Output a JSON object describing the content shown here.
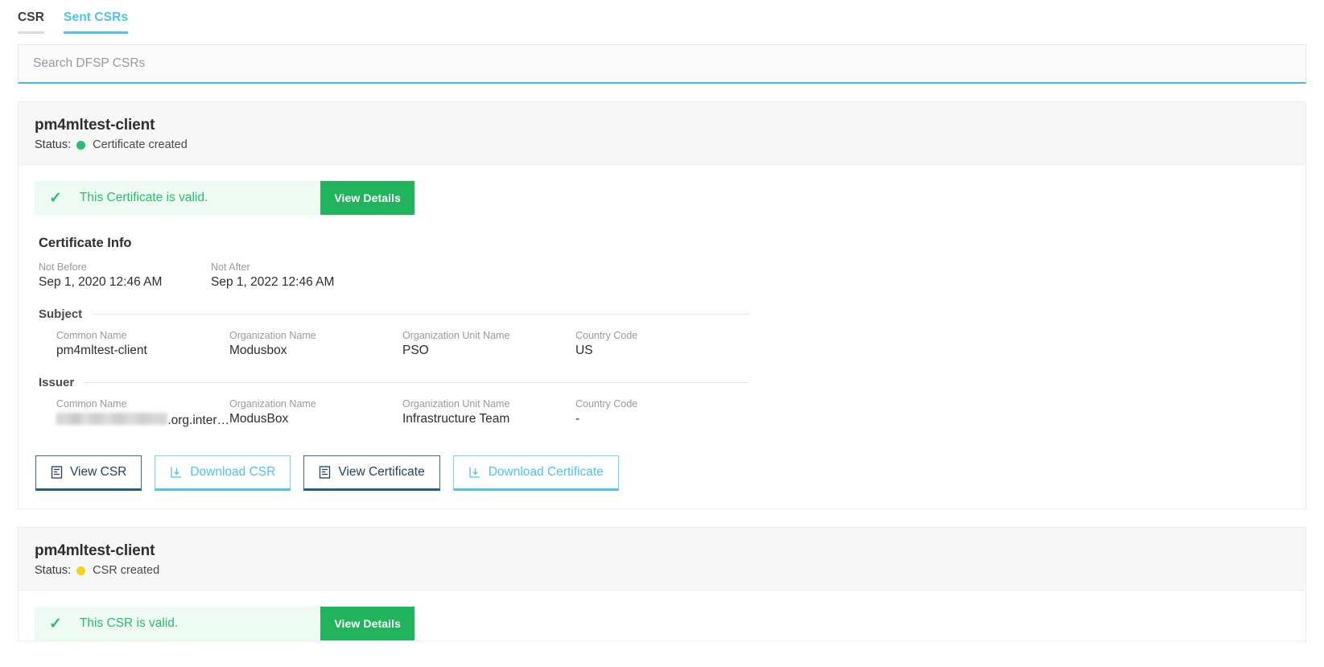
{
  "tabs": [
    {
      "label": "CSR",
      "active": false
    },
    {
      "label": "Sent CSRs",
      "active": true
    }
  ],
  "search": {
    "placeholder": "Search DFSP CSRs",
    "value": ""
  },
  "colors": {
    "accent": "#4ec3f0",
    "success": "#2bbd6b",
    "success_button": "#22b35d",
    "success_bg": "#edfbf2",
    "warning": "#f6d115",
    "dark_button": "#21435e",
    "header_bg": "#f7f7f7"
  },
  "cards": [
    {
      "title": "pm4mltest-client",
      "status_label": "Status:",
      "status_dot": "green",
      "status_text": "Certificate created",
      "alert": {
        "icon": "check-icon",
        "text": "This Certificate is valid.",
        "button": "View Details"
      },
      "section_title": "Certificate Info",
      "validity": [
        {
          "label": "Not Before",
          "value": "Sep 1, 2020 12:46 AM"
        },
        {
          "label": "Not After",
          "value": "Sep 1, 2022 12:46 AM"
        }
      ],
      "subject": {
        "heading": "Subject",
        "fields": [
          {
            "label": "Common Name",
            "value": "pm4mltest-client"
          },
          {
            "label": "Organization Name",
            "value": "Modusbox"
          },
          {
            "label": "Organization Unit Name",
            "value": "PSO"
          },
          {
            "label": "Country Code",
            "value": "US"
          }
        ]
      },
      "issuer": {
        "heading": "Issuer",
        "fields": [
          {
            "label": "Common Name",
            "value": ".org.inter…",
            "redacted": true
          },
          {
            "label": "Organization Name",
            "value": "ModusBox"
          },
          {
            "label": "Organization Unit Name",
            "value": "Infrastructure Team"
          },
          {
            "label": "Country Code",
            "value": "-"
          }
        ]
      },
      "actions": [
        {
          "label": "View CSR",
          "icon": "document-icon",
          "style": "dark"
        },
        {
          "label": "Download CSR",
          "icon": "download-icon",
          "style": "light"
        },
        {
          "label": "View Certificate",
          "icon": "document-icon",
          "style": "dark"
        },
        {
          "label": "Download Certificate",
          "icon": "download-icon",
          "style": "light"
        }
      ]
    },
    {
      "title": "pm4mltest-client",
      "status_label": "Status:",
      "status_dot": "yellow",
      "status_text": "CSR created",
      "alert": {
        "icon": "check-icon",
        "text": "This CSR is valid.",
        "button": "View Details"
      }
    }
  ]
}
